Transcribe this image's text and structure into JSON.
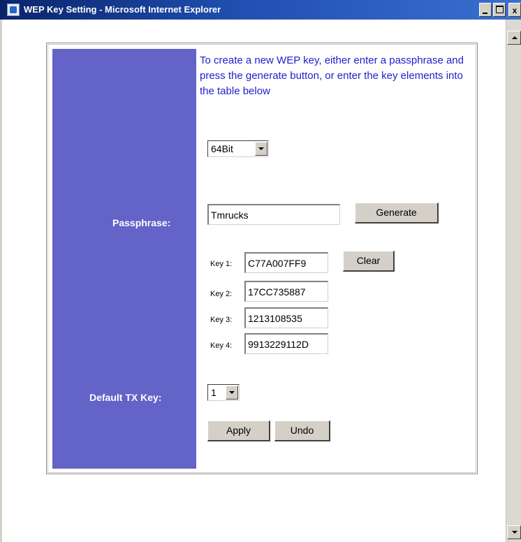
{
  "window": {
    "title": "WEP Key Setting - Microsoft Internet Explorer",
    "minimize_label": "_",
    "maximize_label": "",
    "close_label": "x"
  },
  "instructions": "To create a new WEP key, either enter a passphrase and press the generate button, or enter the key elements into the table below",
  "bit_select": {
    "value": "64Bit"
  },
  "passphrase": {
    "label": "Passphrase:",
    "value": "Tmrucks",
    "generate_label": "Generate"
  },
  "keys": [
    {
      "label": "Key 1:",
      "value": "C77A007FF9"
    },
    {
      "label": "Key 2:",
      "value": "17CC735887"
    },
    {
      "label": "Key 3:",
      "value": "1213108535"
    },
    {
      "label": "Key 4:",
      "value": "9913229112D"
    }
  ],
  "clear_label": "Clear",
  "default_tx": {
    "label": "Default TX Key:",
    "value": "1"
  },
  "apply_label": "Apply",
  "undo_label": "Undo",
  "colors": {
    "sidebar": "#6363c8",
    "instruction_text": "#2020d0",
    "titlebar": "#0a246a"
  }
}
